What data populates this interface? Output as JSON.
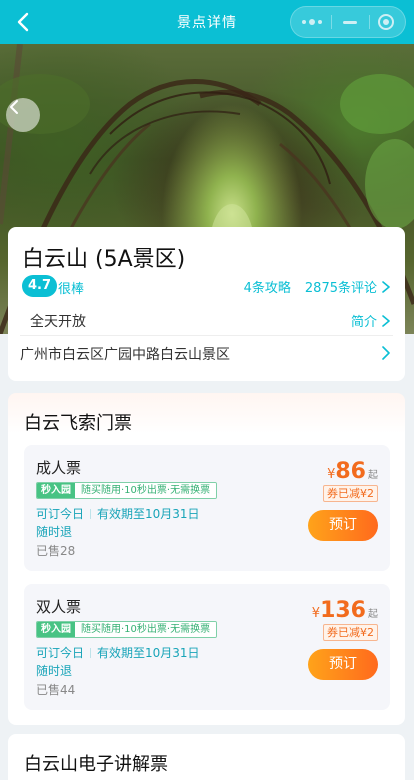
{
  "header": {
    "title": "景点详情"
  },
  "poi": {
    "name": "白云山 (5A景区)",
    "score": "4.7",
    "score_word": "很棒",
    "guides": "4条攻略",
    "reviews": "2875条评论",
    "open_time": "全天开放",
    "intro_label": "简介",
    "address": "广州市白云区广园中路白云山景区"
  },
  "sections": [
    {
      "title": "白云飞索门票",
      "tickets": [
        {
          "name": "成人票",
          "tag_a": "秒入园",
          "tag_b": "随买随用·10秒出票·无需换票",
          "book_today": "可订今日",
          "valid": "有效期至10月31日",
          "refund": "随时退",
          "sold": "已售28",
          "currency": "¥",
          "price": "86",
          "price_suffix": "起",
          "discount": "券已减¥2",
          "button": "预订"
        },
        {
          "name": "双人票",
          "tag_a": "秒入园",
          "tag_b": "随买随用·10秒出票·无需换票",
          "book_today": "可订今日",
          "valid": "有效期至10月31日",
          "refund": "随时退",
          "sold": "已售44",
          "currency": "¥",
          "price": "136",
          "price_suffix": "起",
          "discount": "券已减¥2",
          "button": "预订"
        }
      ]
    },
    {
      "title": "白云山电子讲解票"
    }
  ],
  "icons": {
    "back": "chevron-left-icon",
    "more": "more-dots-icon",
    "minimize": "minus-icon",
    "close": "target-icon",
    "hero_prev": "chevron-left-icon",
    "arrow": "chevron-right-icon"
  },
  "colors": {
    "brand": "#0bbfd4",
    "price": "#f26b1d",
    "tag_green": "#48c384"
  }
}
